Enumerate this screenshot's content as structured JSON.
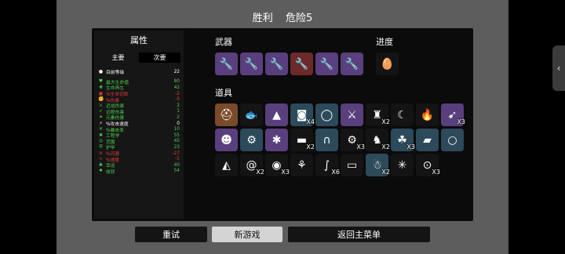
{
  "header": {
    "result": "胜利",
    "danger": "危险5"
  },
  "stats": {
    "title": "属性",
    "tabs": [
      "主要",
      "次要"
    ],
    "level": {
      "label": "目前等级",
      "value": "22"
    },
    "rows": [
      {
        "icon": "heart-icon",
        "glyph": "♥",
        "color": "#4bd14b",
        "label": "最大生命值",
        "value": "80"
      },
      {
        "icon": "regen-icon",
        "glyph": "✚",
        "color": "#4bd14b",
        "label": "生命再生",
        "value": "42"
      },
      {
        "icon": "lifesteal-icon",
        "glyph": "▣",
        "color": "#e23b3b",
        "label": "%生命窃取",
        "value": "-2"
      },
      {
        "icon": "damage-icon",
        "glyph": "✊",
        "color": "#e23b3b",
        "label": "%伤害",
        "value": "-5"
      },
      {
        "icon": "melee-icon",
        "glyph": "⚔",
        "color": "#4bd14b",
        "label": "近战伤害",
        "value": "2"
      },
      {
        "icon": "ranged-icon",
        "glyph": "➶",
        "color": "#4bd14b",
        "label": "远程伤害",
        "value": "1"
      },
      {
        "icon": "elemental-icon",
        "glyph": "✦",
        "color": "#4bd14b",
        "label": "元素伤害",
        "value": "2"
      },
      {
        "icon": "attack-speed-icon",
        "glyph": "⚡",
        "color": "#ffffff",
        "label": "%攻击速度",
        "value": "0"
      },
      {
        "icon": "crit-icon",
        "glyph": "✕",
        "color": "#4bd14b",
        "label": "%暴击率",
        "value": "10"
      },
      {
        "icon": "engineering-icon",
        "glyph": "✖",
        "color": "#4bd14b",
        "label": "工程学",
        "value": "55"
      },
      {
        "icon": "range-icon",
        "glyph": "◎",
        "color": "#4bd14b",
        "label": "范围",
        "value": "45"
      },
      {
        "icon": "armor-icon",
        "glyph": "⛨",
        "color": "#4bd14b",
        "label": "护甲",
        "value": "23"
      },
      {
        "icon": "dodge-icon",
        "glyph": "≋",
        "color": "#e23b3b",
        "label": "%闪避",
        "value": "-27"
      },
      {
        "icon": "speed-icon",
        "glyph": "»",
        "color": "#e23b3b",
        "label": "%速度",
        "value": "-5"
      },
      {
        "icon": "luck-icon",
        "glyph": "♣",
        "color": "#4bd14b",
        "label": "幸运",
        "value": "40"
      },
      {
        "icon": "harvesting-icon",
        "glyph": "♠",
        "color": "#4bd14b",
        "label": "收获",
        "value": "54"
      }
    ]
  },
  "weapons": {
    "title": "武器",
    "items": [
      {
        "icon": "wrench-icon",
        "tier": "purple"
      },
      {
        "icon": "wrench-icon",
        "tier": "purple"
      },
      {
        "icon": "wrench-icon",
        "tier": "purple"
      },
      {
        "icon": "wrench-icon",
        "tier": "red"
      },
      {
        "icon": "wrench-icon",
        "tier": "purple"
      },
      {
        "icon": "wrench-icon",
        "tier": "purple"
      }
    ]
  },
  "progress": {
    "title": "进度",
    "items": [
      {
        "icon": "egg-icon",
        "tier": "dark"
      }
    ]
  },
  "items": {
    "title": "道具",
    "rows": [
      [
        {
          "icon": "helmet-icon",
          "tier": "orange",
          "count": ""
        },
        {
          "icon": "fish-icon",
          "tier": "dark",
          "count": ""
        },
        {
          "icon": "tank-icon",
          "tier": "purple",
          "count": ""
        },
        {
          "icon": "robot-icon",
          "tier": "blue",
          "count": "X4"
        },
        {
          "icon": "ring-icon",
          "tier": "blue",
          "count": ""
        },
        {
          "icon": "sword-icon",
          "tier": "purple",
          "count": ""
        },
        {
          "icon": "turret-icon",
          "tier": "dark",
          "count": "X2"
        },
        {
          "icon": "claw-icon",
          "tier": "dark",
          "count": ""
        },
        {
          "icon": "campfire-icon",
          "tier": "dark",
          "count": ""
        },
        {
          "icon": "rocket-icon",
          "tier": "purple",
          "count": "X3"
        }
      ],
      [
        {
          "icon": "alien-icon",
          "tier": "purple",
          "count": ""
        },
        {
          "icon": "engine-icon",
          "tier": "blue",
          "count": ""
        },
        {
          "icon": "spider-icon",
          "tier": "purple",
          "count": ""
        },
        {
          "icon": "bar-icon",
          "tier": "dark",
          "count": "X2"
        },
        {
          "icon": "magnet-icon",
          "tier": "blue",
          "count": ""
        },
        {
          "icon": "gear-icon",
          "tier": "dark",
          "count": "X3"
        },
        {
          "icon": "bunny-icon",
          "tier": "dark",
          "count": "X2"
        },
        {
          "icon": "frog-icon",
          "tier": "blue",
          "count": "X3"
        },
        {
          "icon": "brick-icon",
          "tier": "blue",
          "count": ""
        },
        {
          "icon": "coin-icon",
          "tier": "blue",
          "count": ""
        }
      ],
      [
        {
          "icon": "cake-icon",
          "tier": "dark",
          "count": ""
        },
        {
          "icon": "snail-icon",
          "tier": "dark",
          "count": "X2"
        },
        {
          "icon": "bag-icon",
          "tier": "dark",
          "count": "X3"
        },
        {
          "icon": "sprout-icon",
          "tier": "dark",
          "count": ""
        },
        {
          "icon": "worm-icon",
          "tier": "dark",
          "count": "X6"
        },
        {
          "icon": "money-icon",
          "tier": "dark",
          "count": ""
        },
        {
          "icon": "bot-icon",
          "tier": "blue",
          "count": "X2"
        },
        {
          "icon": "bug-icon",
          "tier": "dark",
          "count": ""
        },
        {
          "icon": "lantern-icon",
          "tier": "dark",
          "count": "X3"
        }
      ]
    ]
  },
  "buttons": {
    "retry": "重试",
    "new_game": "新游戏",
    "main_menu": "返回主菜单"
  },
  "side_handle": {
    "glyph": "‹"
  }
}
